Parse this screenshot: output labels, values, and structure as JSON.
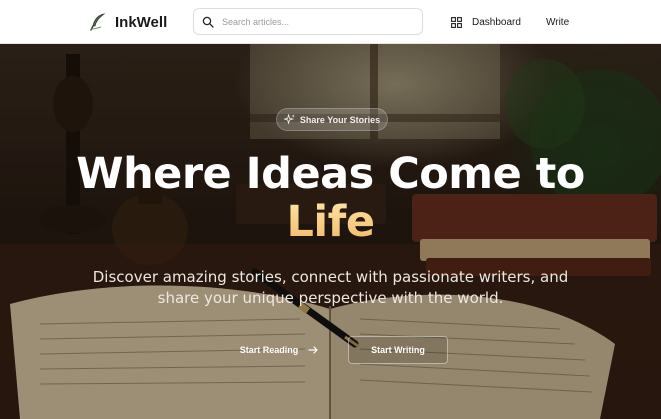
{
  "app": {
    "brand_name": "InkWell",
    "logo_icon": "quill-logo-icon"
  },
  "header": {
    "search": {
      "placeholder": "Search articles...",
      "value": "",
      "icon": "search-icon"
    },
    "nav": {
      "dashboard_label": "Dashboard",
      "dashboard_icon": "grid-icon",
      "write_label": "Write"
    }
  },
  "hero": {
    "badge": {
      "label": "Share Your Stories",
      "icon": "sparkle-icon"
    },
    "title_line1": "Where Ideas Come to",
    "title_accent": "Life",
    "subtitle": "Discover amazing stories, connect with passionate writers, and share your unique perspective with the world.",
    "primary_button": {
      "label": "Start Reading",
      "icon": "arrow-right-icon"
    },
    "secondary_button": {
      "label": "Start Writing"
    }
  },
  "colors": {
    "accent_gradient_start": "#fde7a6",
    "accent_gradient_end": "#f2b766",
    "header_bg": "#ffffff",
    "text_dark": "#1a1a1a"
  }
}
